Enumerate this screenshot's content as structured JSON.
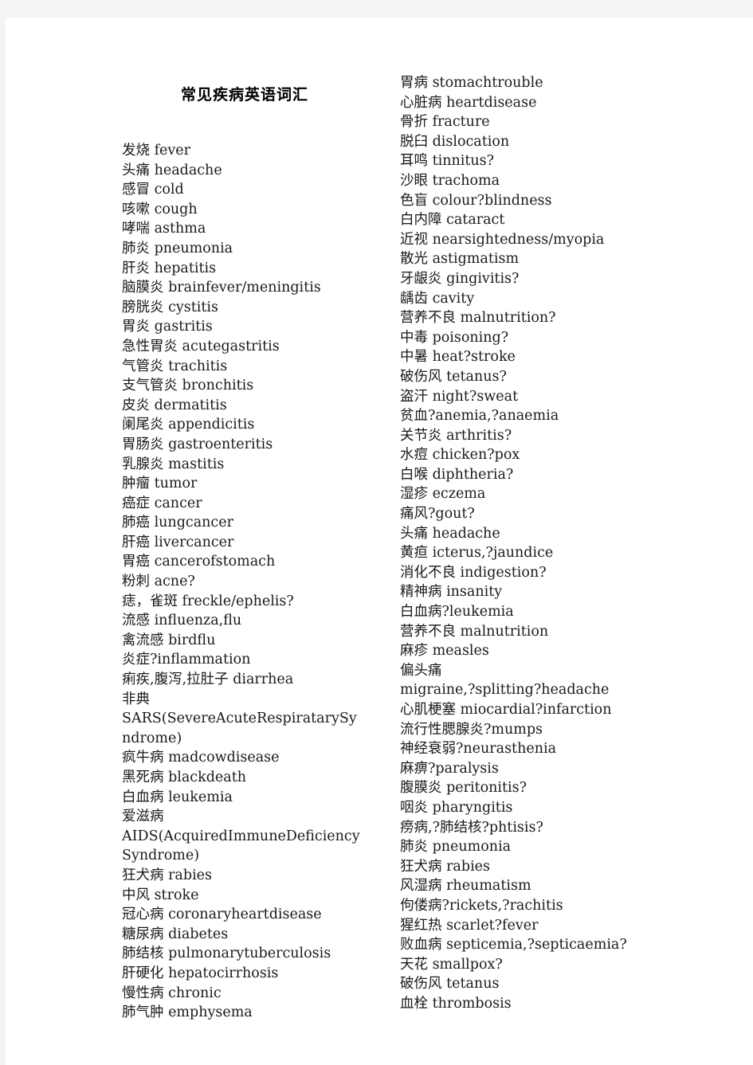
{
  "document": {
    "title": "常见疾病英语词汇",
    "background_color": "#f4f4f4",
    "page_color": "#ffffff",
    "text_color": "#1a1a1a"
  },
  "left_column": {
    "entries": [
      "发烧 fever",
      "头痛 headache",
      "感冒 cold",
      "咳嗽 cough",
      "哮喘 asthma",
      "肺炎 pneumonia",
      "肝炎 hepatitis",
      "脑膜炎 brainfever/meningitis",
      "膀胱炎 cystitis",
      "胃炎 gastritis",
      "急性胃炎 acutegastritis",
      "气管炎 trachitis",
      "支气管炎 bronchitis",
      "皮炎 dermatitis",
      "阑尾炎 appendicitis",
      "胃肠炎 gastroenteritis",
      "乳腺炎 mastitis",
      "肿瘤 tumor",
      "癌症 cancer",
      "肺癌 lungcancer",
      "肝癌 livercancer",
      "胃癌 cancerofstomach",
      "粉刺 acne?",
      "痣，雀斑 freckle/ephelis?",
      "流感 influenza,flu",
      "禽流感 birdflu",
      "炎症?inflammation",
      "痢疾,腹泻,拉肚子 diarrhea",
      "非典",
      "SARS(SevereAcuteRespiratarySyndrome)",
      "疯牛病 madcowdisease",
      "黑死病 blackdeath",
      "白血病 leukemia",
      "爱滋病",
      "AIDS(AcquiredImmuneDeficiencySyndrome)",
      "狂犬病 rabies",
      "中风 stroke",
      "冠心病 coronaryheartdisease",
      "糖尿病 diabetes",
      "肺结核 pulmonarytuberculosis",
      "肝硬化 hepatocirrhosis",
      "慢性病 chronic",
      "肺气肿 emphysema"
    ]
  },
  "right_column": {
    "entries": [
      "胃病 stomachtrouble",
      "心脏病 heartdisease",
      "骨折 fracture",
      "脱臼 dislocation",
      "耳鸣 tinnitus?",
      "沙眼 trachoma",
      "色盲 colour?blindness",
      "白内障 cataract",
      "近视 nearsightedness/myopia",
      "散光 astigmatism",
      "牙龈炎 gingivitis?",
      "龋齿 cavity",
      "营养不良 malnutrition?",
      "中毒 poisoning?",
      "中暑 heat?stroke",
      "破伤风 tetanus?",
      "盗汗 night?sweat",
      "贫血?anemia,?anaemia",
      "关节炎 arthritis?",
      "水痘 chicken?pox",
      "白喉 diphtheria?",
      "湿疹 eczema",
      "痛风?gout?",
      "头痛 headache",
      "黄疸 icterus,?jaundice",
      "消化不良 indigestion?",
      "精神病 insanity",
      "白血病?leukemia",
      "营养不良 malnutrition",
      "麻疹 measles",
      "偏头痛",
      "migraine,?splitting?headache",
      "心肌梗塞 miocardial?infarction",
      "流行性腮腺炎?mumps",
      "神经衰弱?neurasthenia",
      "麻痹?paralysis",
      "腹膜炎 peritonitis?",
      "咽炎 pharyngitis",
      "痨病,?肺结核?phtisis?",
      "肺炎 pneumonia",
      "狂犬病 rabies",
      "风湿病 rheumatism",
      "佝偻病?rickets,?rachitis",
      "猩红热 scarlet?fever",
      "败血病 septicemia,?septicaemia?",
      "天花 smallpox?",
      "破伤风 tetanus",
      "血栓 thrombosis"
    ]
  }
}
